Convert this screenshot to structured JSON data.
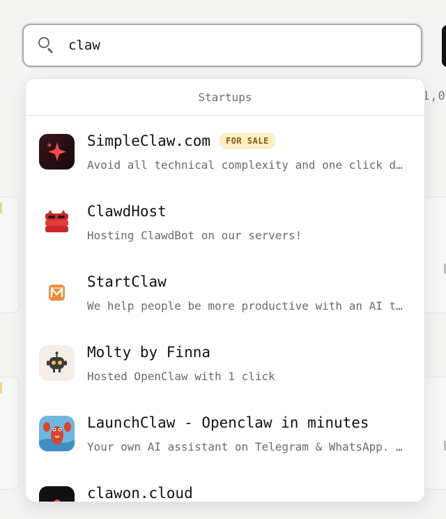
{
  "search": {
    "query": "claw",
    "placeholder": ""
  },
  "background": {
    "peek_text": "1,0"
  },
  "dropdown": {
    "section_header": "Startups",
    "items": [
      {
        "title": "SimpleClaw.com",
        "badge": "FOR SALE",
        "description": "Avoid all technical complexity and one click de…",
        "icon": "sparkle-icon"
      },
      {
        "title": "ClawdHost",
        "badge": "",
        "description": "Hosting ClawdBot on our servers!",
        "icon": "server-stack-icon"
      },
      {
        "title": "StartClaw",
        "badge": "",
        "description": "We help people be more productive with an AI tr…",
        "icon": "m-logo-icon"
      },
      {
        "title": "Molty by Finna",
        "badge": "",
        "description": "Hosted OpenClaw with 1 click",
        "icon": "robot-icon"
      },
      {
        "title": "LaunchClaw - Openclaw in minutes",
        "badge": "",
        "description": "Your own AI assistant on Telegram & WhatsApp. N…",
        "icon": "lobster-icon"
      },
      {
        "title": "clawon.cloud",
        "badge": "",
        "description": "",
        "icon": "cloud-logo-icon"
      }
    ]
  },
  "colors": {
    "badge_bg": "#fcefc7",
    "badge_text": "#8a5a0b",
    "accent_red": "#e03a3a"
  }
}
